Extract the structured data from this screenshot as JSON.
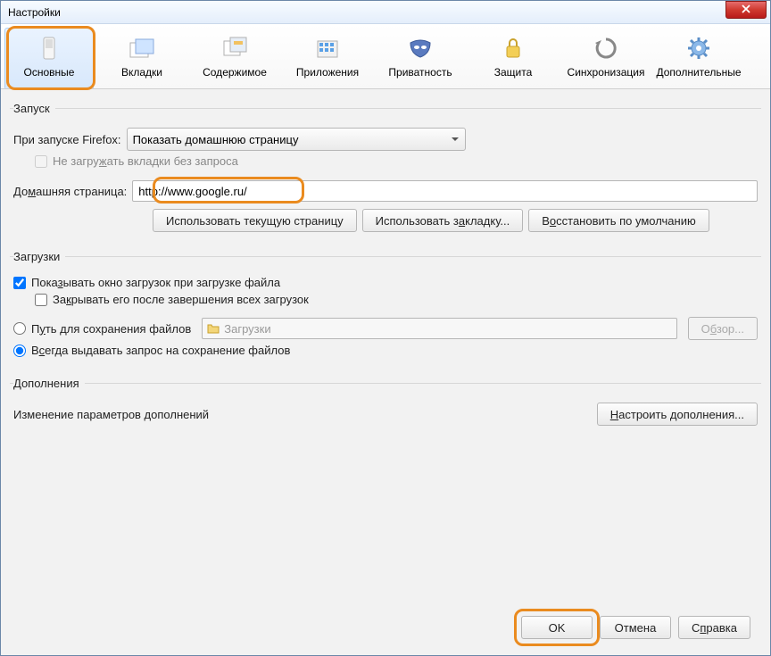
{
  "window": {
    "title": "Настройки"
  },
  "toolbar": {
    "items": [
      {
        "label": "Основные"
      },
      {
        "label": "Вкладки"
      },
      {
        "label": "Содержимое"
      },
      {
        "label": "Приложения"
      },
      {
        "label": "Приватность"
      },
      {
        "label": "Защита"
      },
      {
        "label": "Синхронизация"
      },
      {
        "label": "Дополнительные"
      }
    ]
  },
  "startup": {
    "legend": "Запуск",
    "firefox_start_label": "При запуске Firefox:",
    "firefox_start_value": "Показать домашнюю страницу",
    "dont_load_tabs": "Не загружать вкладки без запроса",
    "homepage_label": "Домашняя страница:",
    "homepage_value": "http://www.google.ru/",
    "btn_use_current": "Использовать текущую страницу",
    "btn_use_bookmark": "Использовать закладку...",
    "btn_restore_default": "Восстановить по умолчанию"
  },
  "downloads": {
    "legend": "Загрузки",
    "show_window": "Показывать окно загрузок при загрузке файла",
    "close_after": "Закрывать его после завершения всех загрузок",
    "save_path_label": "Путь для сохранения файлов",
    "save_path_value": "Загрузки",
    "browse": "Обзор...",
    "always_ask": "Всегда выдавать запрос на сохранение файлов"
  },
  "addons": {
    "legend": "Дополнения",
    "desc": "Изменение параметров дополнений",
    "btn_configure": "Настроить дополнения..."
  },
  "footer": {
    "ok": "OK",
    "cancel": "Отмена",
    "help": "Справка"
  }
}
